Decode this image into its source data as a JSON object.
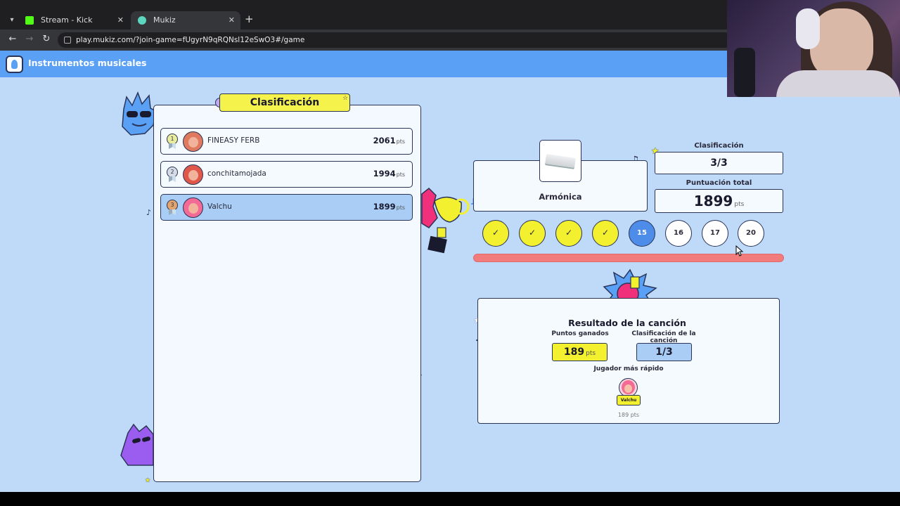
{
  "browser": {
    "tabs": [
      {
        "label": "Stream - Kick Dashboard",
        "active": false
      },
      {
        "label": "Mukiz",
        "active": true
      }
    ],
    "url": "play.mukiz.com/?join-game=fUgyrN9qRQNsl12eSwO3#/game"
  },
  "app": {
    "title": "Instrumentos musicales"
  },
  "leaderboard": {
    "title": "Clasificación",
    "pts_suffix": "pts",
    "rows": [
      {
        "rank": "1",
        "name": "FINEASY FERB",
        "score": "2061",
        "me": false
      },
      {
        "rank": "2",
        "name": "conchitamojada",
        "score": "1994",
        "me": false
      },
      {
        "rank": "3",
        "name": "Valchu",
        "score": "1899",
        "me": true
      }
    ]
  },
  "instrument": {
    "name": "Armónica"
  },
  "stats": {
    "rank_label": "Clasificación",
    "rank_value": "3/3",
    "total_label": "Puntuación total",
    "total_value": "1899",
    "pts_suffix": "pts"
  },
  "rounds": [
    {
      "label": "✓",
      "state": "done"
    },
    {
      "label": "✓",
      "state": "done"
    },
    {
      "label": "✓",
      "state": "done"
    },
    {
      "label": "✓",
      "state": "done"
    },
    {
      "label": "15",
      "state": "current"
    },
    {
      "label": "16",
      "state": "todo"
    },
    {
      "label": "17",
      "state": "todo"
    },
    {
      "label": "20",
      "state": "todo"
    }
  ],
  "progress": {
    "fraction": 1.0,
    "color": "#f27b7b"
  },
  "result": {
    "title": "Resultado de la canción",
    "points_label": "Puntos ganados",
    "points_value": "189",
    "pts_suffix": "pts",
    "rank_label": "Clasificación de la canción",
    "rank_value": "1/3",
    "fastest_label": "Jugador más rápido",
    "fastest_name": "Valchu",
    "fastest_pts": "189 pts"
  },
  "colors": {
    "accent_blue": "#5aa0f4",
    "background": "#bfdaf8",
    "yellow": "#f3f02f",
    "highlight_row": "#a9cdf5"
  }
}
